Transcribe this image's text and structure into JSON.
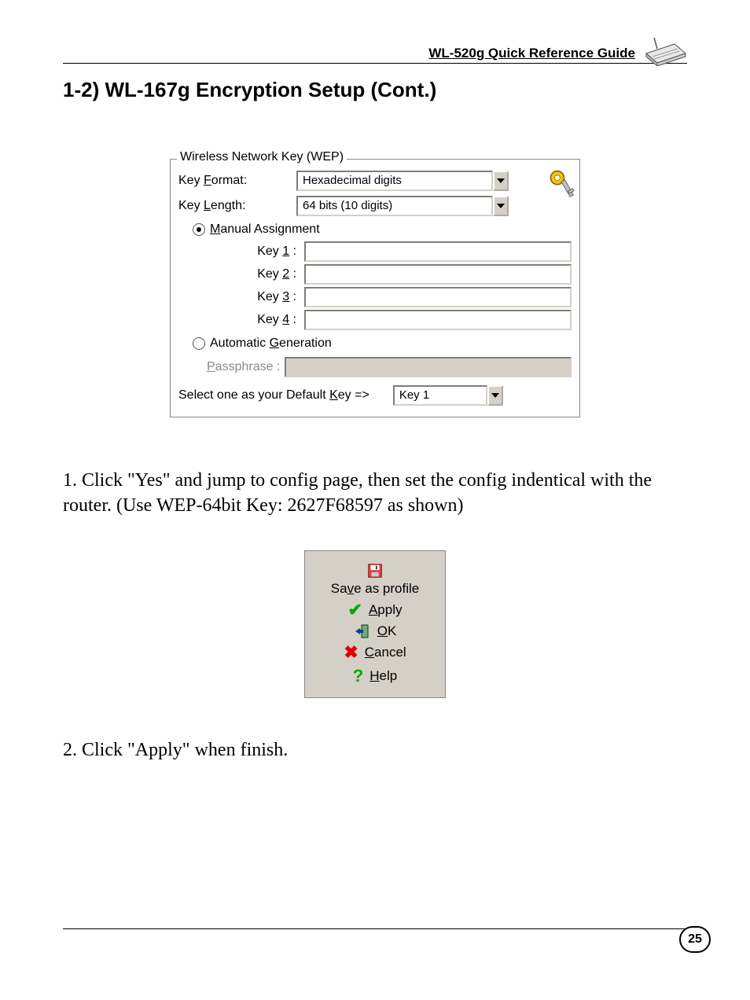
{
  "header": {
    "guide_title": "WL-520g Quick Reference Guide"
  },
  "section": {
    "title": "1-2) WL-167g Encryption Setup (Cont.)"
  },
  "dialog": {
    "legend": "Wireless Network Key (WEP)",
    "key_format_label": "Key Format:",
    "key_format_value": "Hexadecimal digits",
    "key_length_label": "Key Length:",
    "key_length_value": "64 bits (10 digits)",
    "manual_label": "Manual Assignment",
    "key1_label": "Key 1 :",
    "key2_label": "Key 2 :",
    "key3_label": "Key 3 :",
    "key4_label": "Key 4 :",
    "auto_label": "Automatic Generation",
    "passphrase_label": "Passphrase :",
    "default_label": "Select one as your Default Key =>",
    "default_value": "Key 1"
  },
  "instructions": {
    "step1": "1. Click \"Yes\" and jump to config page, then set the config indentical with the router. (Use WEP-64bit Key: 2627F68597 as shown)",
    "step2": "2. Click \"Apply\" when finish."
  },
  "buttons": {
    "save": "Save as profile",
    "apply": "Apply",
    "ok": "OK",
    "cancel": "Cancel",
    "help": "Help"
  },
  "page_number": "25"
}
